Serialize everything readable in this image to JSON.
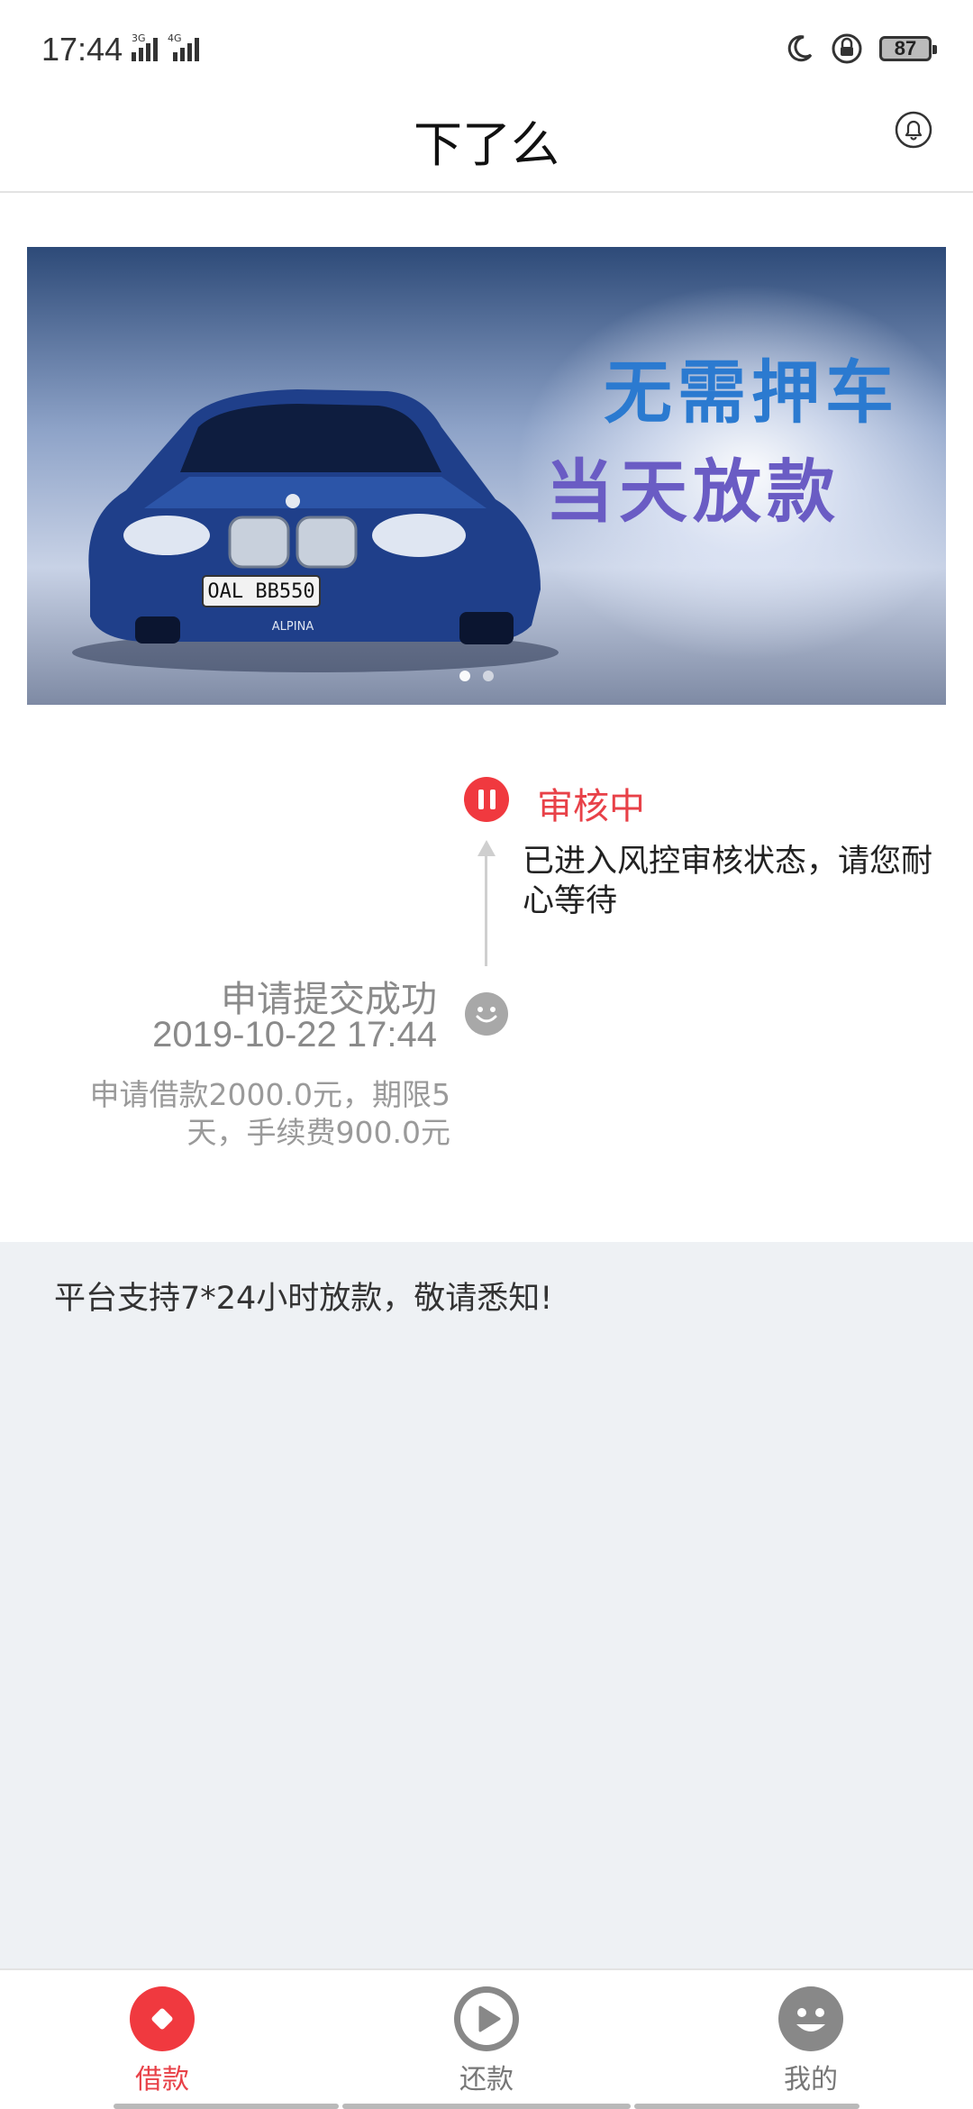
{
  "status_bar": {
    "time": "17:44",
    "network_a": "3G",
    "network_b": "4G",
    "battery": "87",
    "icons": [
      "moon-icon",
      "rotation-lock-icon",
      "battery-icon"
    ]
  },
  "header": {
    "title": "下了么",
    "icon": "bell-icon"
  },
  "banner": {
    "line1": "无需押车",
    "line2": "当天放款",
    "plate": "OAL BB550",
    "badge": "ALPINA",
    "dots_count": 2,
    "active_dot": 1
  },
  "timeline": {
    "current": {
      "title": "审核中",
      "description": "已进入风控审核状态，请您耐心等待",
      "icon": "pause-icon",
      "color": "#e84148"
    },
    "past": {
      "title": "申请提交成功",
      "time": "2019-10-22 17:44",
      "description": "申请借款2000.0元，期限5天，手续费900.0元",
      "icon": "smile-icon"
    }
  },
  "notice": {
    "text": "平台支持7*24小时放款，敬请悉知!"
  },
  "tabs": [
    {
      "label": "借款",
      "icon": "diamond-icon",
      "active": true
    },
    {
      "label": "还款",
      "icon": "play-icon",
      "active": false
    },
    {
      "label": "我的",
      "icon": "smile-face-icon",
      "active": false
    }
  ],
  "colors": {
    "accent": "#f0393f",
    "notice_bg": "#eef1f4"
  }
}
